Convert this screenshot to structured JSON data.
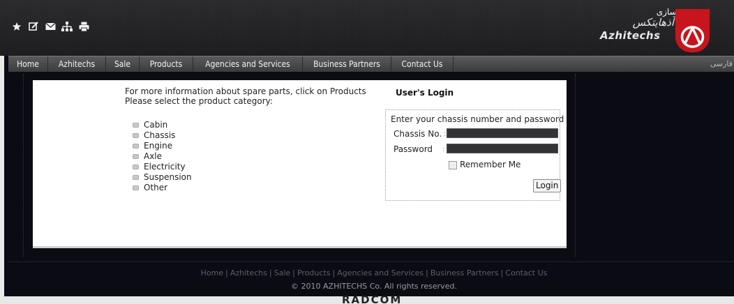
{
  "header": {
    "toolbar": [
      {
        "name": "favorite-star-icon"
      },
      {
        "name": "edit-icon"
      },
      {
        "name": "mail-icon"
      },
      {
        "name": "sitemap-icon"
      },
      {
        "name": "print-icon"
      }
    ],
    "logo_persian_top": "خودرو سازی",
    "logo_persian_main": "آذهایتکس",
    "logo_english": "Azhitechs",
    "brand_color": "#c8141c"
  },
  "nav": {
    "items": [
      "Home",
      "Azhitechs",
      "Sale",
      "Products",
      "Agencies and Services",
      "Business Partners",
      "Contact Us"
    ],
    "language": "فارسی"
  },
  "main": {
    "info_line1": "For more information about spare parts, click on Products",
    "info_line2": "Please select the product category:",
    "categories": [
      "Cabin",
      "Chassis",
      "Engine",
      "Axle",
      "Electricity",
      "Suspension",
      "Other"
    ]
  },
  "login": {
    "title": "User's Login",
    "hint": "Enter your chassis number and  password",
    "chassis_label": "Chassis No.",
    "password_label": "Password",
    "colon": ":",
    "chassis_value": "",
    "password_value": "",
    "remember_label": "Remember Me",
    "button_label": "Login"
  },
  "footer": {
    "links": [
      "Home",
      "Azhitechs",
      "Sale",
      "Products",
      "Agencies and Services",
      "Business Partners",
      "Contact Us"
    ],
    "separator": "|",
    "copyright": "© 2010 AZHITECHS Co. All rights reserved.",
    "designer": "RADCOM"
  }
}
